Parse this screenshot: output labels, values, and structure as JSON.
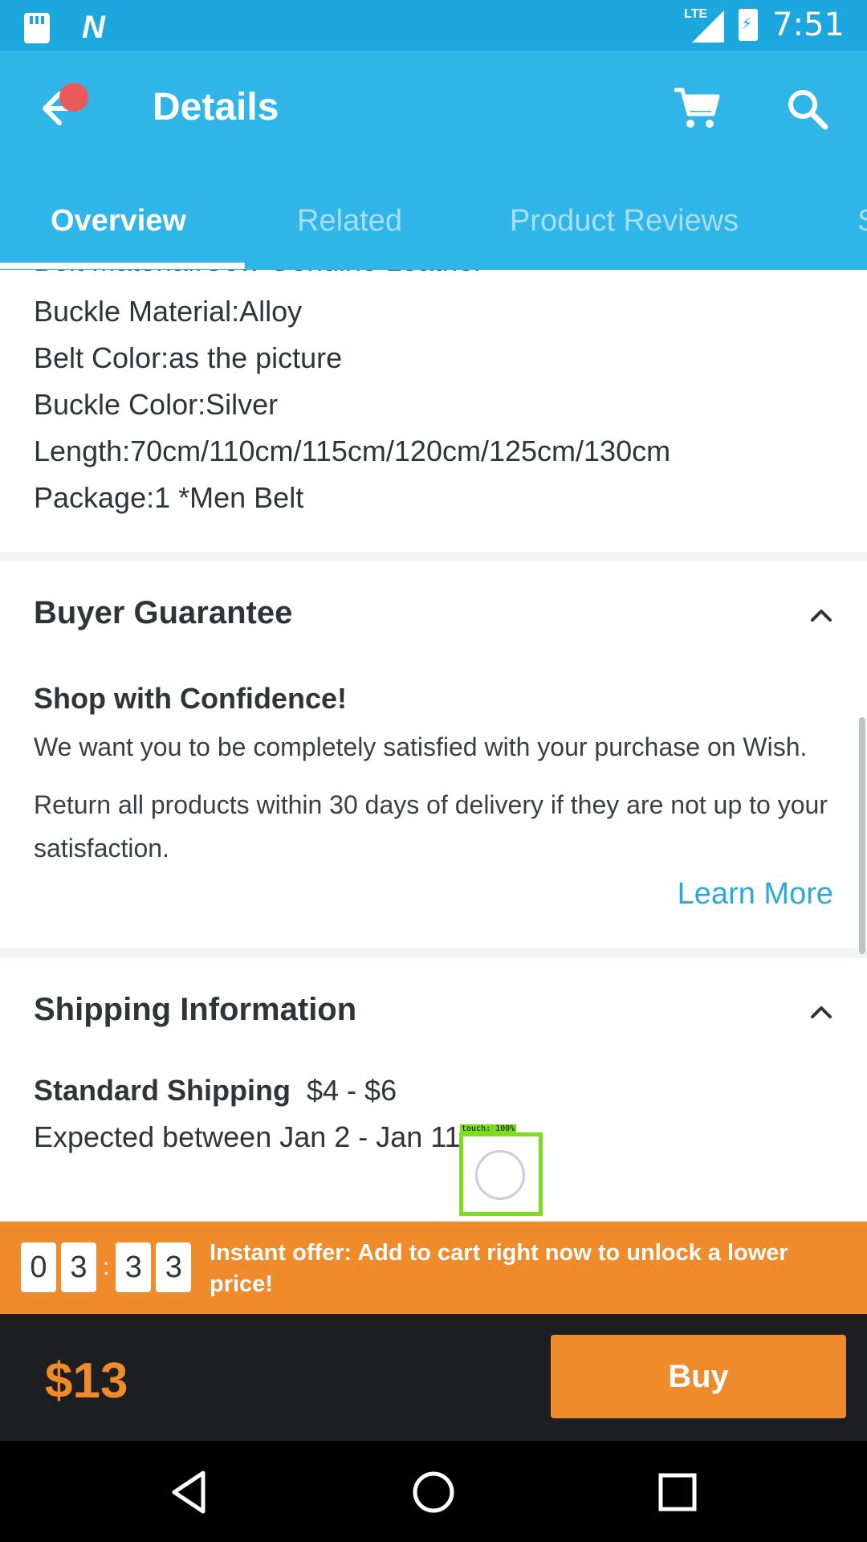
{
  "status_bar": {
    "time": "7:51",
    "network": "LTE"
  },
  "app_bar": {
    "title": "Details"
  },
  "tabs": [
    {
      "label": "Overview"
    },
    {
      "label": "Related"
    },
    {
      "label": "Product Reviews"
    },
    {
      "label": "S"
    }
  ],
  "specs": {
    "cut_line": "Belt Material:Cow Genuine Leather",
    "lines": [
      "Buckle Material:Alloy",
      "Belt Color:as the picture",
      "Buckle Color:Silver",
      "Length:70cm/110cm/115cm/120cm/125cm/130cm",
      "Package:1 *Men Belt"
    ]
  },
  "buyer_guarantee": {
    "title": "Buyer Guarantee",
    "subtitle": "Shop with Confidence!",
    "para1": "We want you to be completely satisfied with your purchase on Wish.",
    "para2": "Return all products within 30 days of delivery if they are not up to your satisfaction.",
    "learn_more": "Learn More"
  },
  "shipping": {
    "title": "Shipping Information",
    "standard_label": "Standard Shipping",
    "price_range": "$4 - $6",
    "expected": "Expected between Jan 2 - Jan 11"
  },
  "touch_overlay": {
    "label": "touch: 100%"
  },
  "offer": {
    "timer_digits": [
      "0",
      "3",
      "3",
      "3"
    ],
    "text": "Instant offer: Add to cart right now to unlock a lower price!"
  },
  "buy_bar": {
    "price": "$13",
    "buy_label": "Buy"
  },
  "colors": {
    "primary": "#2fb5e8",
    "accent": "#f08b2c",
    "link": "#2ba9db"
  }
}
